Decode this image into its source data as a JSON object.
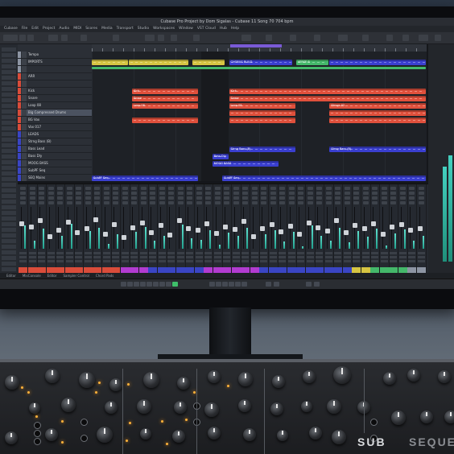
{
  "window": {
    "title": "Cubase Pro Project by Dom Sigalas - Cubase 11 Song 70 704 bpm",
    "menu": [
      "Cubase",
      "File",
      "Edit",
      "Project",
      "Audio",
      "MIDI",
      "Scores",
      "Media",
      "Transport",
      "Studio",
      "Workspaces",
      "Window",
      "VST Cloud",
      "Hub",
      "Help"
    ]
  },
  "tracks": [
    {
      "name": "Tempo",
      "color": "#8d95a3"
    },
    {
      "name": "IMPORTS",
      "color": "#8d95a3"
    },
    {
      "name": "",
      "color": "#8d95a3"
    },
    {
      "name": "ARR",
      "color": "#d94c3a"
    },
    {
      "name": "",
      "color": "#d94c3a"
    },
    {
      "name": "Kick",
      "color": "#d94c3a"
    },
    {
      "name": "Snare",
      "color": "#d94c3a"
    },
    {
      "name": "Loop 08",
      "color": "#d94c3a"
    },
    {
      "name": "Big Compressed Drums",
      "color": "#d94c3a",
      "selected": true
    },
    {
      "name": "BG Vox",
      "color": "#d94c3a"
    },
    {
      "name": "Vox 017",
      "color": "#d94c3a"
    },
    {
      "name": "LEADS",
      "color": "#3a45c4"
    },
    {
      "name": "Strng Bass (B)",
      "color": "#3a45c4"
    },
    {
      "name": "Bass Lead",
      "color": "#3a45c4"
    },
    {
      "name": "Bass Dly",
      "color": "#3a45c4"
    },
    {
      "name": "MOOG BASS",
      "color": "#3a45c4"
    },
    {
      "name": "SubPF Seq",
      "color": "#3a45c4"
    },
    {
      "name": "SEQ Mains",
      "color": "#3a45c4"
    }
  ],
  "colors": {
    "red_clip": "#e0503c",
    "blue_clip": "#3a3fd0",
    "yellow_clip": "#d6c542",
    "green_clip": "#44b86a",
    "cyan_meter": "#3fcab8",
    "cycle": "#7a5bd6",
    "led": "#ffb23a"
  },
  "clips": [
    {
      "lane": 1,
      "start": 0.0,
      "len": 0.11,
      "color": "yellow",
      "name": ""
    },
    {
      "lane": 1,
      "start": 0.11,
      "len": 0.18,
      "color": "yellow",
      "name": ""
    },
    {
      "lane": 1,
      "start": 0.3,
      "len": 0.1,
      "color": "yellow",
      "name": ""
    },
    {
      "lane": 1,
      "start": 0.41,
      "len": 0.19,
      "color": "blue",
      "name": "CHORUS BUILD"
    },
    {
      "lane": 1,
      "start": 0.61,
      "len": 0.1,
      "color": "green",
      "name": "VERSE B"
    },
    {
      "lane": 1,
      "start": 0.71,
      "len": 0.29,
      "color": "blue",
      "name": ""
    },
    {
      "lane": 2,
      "start": 0.0,
      "len": 1.0,
      "color": "green",
      "name": ""
    },
    {
      "lane": 5,
      "start": 0.12,
      "len": 0.2,
      "color": "red",
      "name": "Kick"
    },
    {
      "lane": 5,
      "start": 0.41,
      "len": 0.59,
      "color": "red",
      "name": "Kick"
    },
    {
      "lane": 6,
      "start": 0.12,
      "len": 0.2,
      "color": "red",
      "name": "Snare"
    },
    {
      "lane": 6,
      "start": 0.41,
      "len": 0.59,
      "color": "red",
      "name": "Snare"
    },
    {
      "lane": 7,
      "start": 0.12,
      "len": 0.2,
      "color": "red",
      "name": "Loop 08"
    },
    {
      "lane": 7,
      "start": 0.41,
      "len": 0.2,
      "color": "red",
      "name": "Loop 08"
    },
    {
      "lane": 7,
      "start": 0.71,
      "len": 0.29,
      "color": "red",
      "name": "Strngs 02"
    },
    {
      "lane": 8,
      "start": 0.41,
      "len": 0.2,
      "color": "red",
      "name": ""
    },
    {
      "lane": 8,
      "start": 0.71,
      "len": 0.29,
      "color": "red",
      "name": ""
    },
    {
      "lane": 9,
      "start": 0.12,
      "len": 0.2,
      "color": "red",
      "name": ""
    },
    {
      "lane": 9,
      "start": 0.41,
      "len": 0.2,
      "color": "red",
      "name": ""
    },
    {
      "lane": 9,
      "start": 0.71,
      "len": 0.29,
      "color": "red",
      "name": ""
    },
    {
      "lane": 13,
      "start": 0.41,
      "len": 0.2,
      "color": "blue",
      "name": "Strng Bass (B)"
    },
    {
      "lane": 13,
      "start": 0.71,
      "len": 0.29,
      "color": "blue",
      "name": "Strng Bass (B)"
    },
    {
      "lane": 14,
      "start": 0.36,
      "len": 0.05,
      "color": "blue",
      "name": "Bass Dly"
    },
    {
      "lane": 15,
      "start": 0.36,
      "len": 0.2,
      "color": "blue",
      "name": "MOOG BASS"
    },
    {
      "lane": 17,
      "start": 0.0,
      "len": 0.32,
      "color": "blue",
      "name": "SubPF Seq"
    },
    {
      "lane": 17,
      "start": 0.39,
      "len": 0.61,
      "color": "blue",
      "name": "SubPF Seq"
    },
    {
      "lane": 18,
      "start": 0.0,
      "len": 0.32,
      "color": "blue",
      "name": ""
    },
    {
      "lane": 18,
      "start": 0.39,
      "len": 0.61,
      "color": "blue",
      "name": ""
    }
  ],
  "mixer": {
    "channel_count": 44,
    "levels": [
      0.62,
      0.55,
      0.7,
      0.3,
      0.45,
      0.66,
      0.4,
      0.5,
      0.72,
      0.35,
      0.6,
      0.28,
      0.52,
      0.64,
      0.4,
      0.58,
      0.33,
      0.7,
      0.5,
      0.46,
      0.62,
      0.38,
      0.55,
      0.48,
      0.68,
      0.3,
      0.5,
      0.6,
      0.42,
      0.57,
      0.36,
      0.65,
      0.52,
      0.44,
      0.7,
      0.4,
      0.58,
      0.49,
      0.62,
      0.35,
      0.55,
      0.6,
      0.45,
      0.5
    ],
    "meters": [
      0.55,
      0.2,
      0.48,
      0.0,
      0.3,
      0.6,
      0.0,
      0.42,
      0.5,
      0.12,
      0.35,
      0.0,
      0.4,
      0.52,
      0.2,
      0.3,
      0.0,
      0.58,
      0.25,
      0.22,
      0.45,
      0.1,
      0.38,
      0.3,
      0.5,
      0.0,
      0.35,
      0.44,
      0.18,
      0.4,
      0.05,
      0.55,
      0.3,
      0.2,
      0.5,
      0.15,
      0.42,
      0.28,
      0.48,
      0.08,
      0.36,
      0.46,
      0.2,
      0.3
    ],
    "label_colors": [
      "#d94c3a",
      "#d94c3a",
      "#d94c3a",
      "#d94c3a",
      "#d94c3a",
      "#d94c3a",
      "#d94c3a",
      "#d94c3a",
      "#d94c3a",
      "#d94c3a",
      "#d94c3a",
      "#b23bd0",
      "#b23bd0",
      "#b23bd0",
      "#3a45c4",
      "#3a45c4",
      "#3a45c4",
      "#3a45c4",
      "#3a45c4",
      "#3a45c4",
      "#b23bd0",
      "#b23bd0",
      "#b23bd0",
      "#b23bd0",
      "#b23bd0",
      "#b23bd0",
      "#3a45c4",
      "#3a45c4",
      "#3a45c4",
      "#3a45c4",
      "#3a45c4",
      "#3a45c4",
      "#3a45c4",
      "#3a45c4",
      "#3a45c4",
      "#3a45c4",
      "#d6c542",
      "#d6c542",
      "#44b86a",
      "#44b86a",
      "#44b86a",
      "#44b86a",
      "#8d95a3",
      "#8d95a3"
    ]
  },
  "bottom_tabs": [
    "Editor",
    "MixConsole",
    "Editor",
    "Sampler Control",
    "Chord Pads"
  ],
  "synth": {
    "brand": "SUB",
    "brand_suffix": "SEQUENT"
  }
}
